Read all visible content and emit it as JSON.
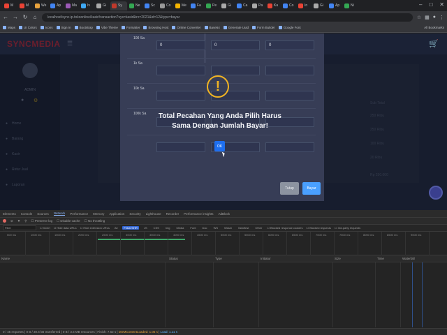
{
  "browser": {
    "tabs": [
      {
        "label": "M",
        "color": "#ea4335",
        "active": false
      },
      {
        "label": "M",
        "color": "#ea4335",
        "active": false
      },
      {
        "label": "We",
        "color": "#e8a33d",
        "active": false
      },
      {
        "label": "Ap",
        "color": "#4285f4",
        "active": false
      },
      {
        "label": "Ma",
        "color": "#9b59b6",
        "active": false
      },
      {
        "label": "Iv",
        "color": "#3fa9f5",
        "active": false
      },
      {
        "label": "Gi",
        "color": "#aaaaaa",
        "active": false
      },
      {
        "label": "Sy",
        "color": "#c0392b",
        "active": true
      },
      {
        "label": "Ne",
        "color": "#34a853",
        "active": false
      },
      {
        "label": "Sc",
        "color": "#4285f4",
        "active": false
      },
      {
        "label": "Co",
        "color": "#999999",
        "active": false
      },
      {
        "label": "Me",
        "color": "#f4b400",
        "active": false
      },
      {
        "label": "Fa",
        "color": "#4285f4",
        "active": false
      },
      {
        "label": "Pe",
        "color": "#34a853",
        "active": false
      },
      {
        "label": "Gi",
        "color": "#aaaaaa",
        "active": false
      },
      {
        "label": "Ca",
        "color": "#4285f4",
        "active": false
      },
      {
        "label": "Pa",
        "color": "#aaaaaa",
        "active": false
      },
      {
        "label": "Ku",
        "color": "#ea4335",
        "active": false
      },
      {
        "label": "Co",
        "color": "#4285f4",
        "active": false
      },
      {
        "label": "In",
        "color": "#ea4335",
        "active": false
      },
      {
        "label": "Gi",
        "color": "#aaaaaa",
        "active": false
      },
      {
        "label": "Ap",
        "color": "#4285f4",
        "active": false
      },
      {
        "label": "Ni",
        "color": "#34a853",
        "active": false
      }
    ],
    "url": "localhost/sync.ip.tokoonline/kasir/transaction?sys=kasir&trx=2021&id=12&type=bayar",
    "bookmarks": [
      "Maps",
      "UI Colors",
      "Icons",
      "Sign In",
      "Bootstrap",
      "Vibe Theme",
      "Formatter",
      "Browsing Host",
      "Online Converter",
      "Base64",
      "Generate Uuid",
      "Form Builder",
      "Google Font"
    ],
    "bookmarks_right": "All Bookmarks"
  },
  "app": {
    "logo": "SYNCMEDIA",
    "user": "ADMIN",
    "menu": [
      "Home",
      "Barang",
      "Kasir",
      "Retur Jual",
      "Laporan"
    ],
    "right_labels": [
      "Sub Total",
      "250 Ribu",
      "250 Ribu",
      "100 Ribu",
      "20 Ribu",
      "Rp 250.000"
    ]
  },
  "modal": {
    "rows": [
      {
        "label": "100 Sa",
        "v1": "0",
        "v2": "0",
        "v3": "0"
      },
      {
        "label": "1k Sa",
        "v1": "",
        "v2": "",
        "v3": ""
      },
      {
        "label": "10k Sa",
        "v1": "",
        "v2": "",
        "v3": ""
      },
      {
        "label": "100k Sa",
        "v1": "",
        "v2": "",
        "v3": ""
      },
      {
        "label": "",
        "v1": "",
        "v2": "",
        "v3": ""
      }
    ],
    "close_label": "Tutup",
    "pay_label": "Bayar"
  },
  "alert": {
    "icon": "!",
    "title": "Total Pecahan Yang Anda Pilih Harus Sama Dengan Jumlah Bayar!",
    "ok_label": "OK"
  },
  "devtools": {
    "tabs": [
      "Elements",
      "Console",
      "Sources",
      "Network",
      "Performance",
      "Memory",
      "Application",
      "Security",
      "Lighthouse",
      "Recorder",
      "Performance insights",
      "AdBlock"
    ],
    "active_tab": "Network",
    "toolbar": [
      "Preserve log",
      "Disable cache",
      "No throttling"
    ],
    "filter_placeholder": "Filter",
    "filter_options": [
      "Invert",
      "Hide data URLs",
      "Hide extension URLs"
    ],
    "type_chips": [
      "All",
      "Fetch/XHR",
      "JS",
      "CSS",
      "Img",
      "Media",
      "Font",
      "Doc",
      "WS",
      "Wasm",
      "Manifest",
      "Other"
    ],
    "type_active": "Fetch/XHR",
    "extra_filters": [
      "Blocked response cookies",
      "Blocked requests",
      "3rd-party requests"
    ],
    "ticks": [
      "500 ms",
      "1000 ms",
      "1500 ms",
      "2000 ms",
      "2500 ms",
      "3000 ms",
      "3500 ms",
      "4000 ms",
      "4500 ms",
      "5000 ms",
      "5500 ms",
      "6000 ms",
      "6500 ms",
      "7000 ms",
      "7500 ms",
      "8000 ms",
      "8500 ms",
      "9000 ms"
    ],
    "columns": [
      "Name",
      "Status",
      "Type",
      "Initiator",
      "Size",
      "Time",
      "Waterfall"
    ],
    "status": {
      "requests": "0 / 45 requests",
      "transferred": "0 B / 30.6 kB transferred",
      "resources": "0 B / 3.5 MB resources",
      "finish": "Finish: 7.62 s",
      "dom": "DOMContentLoaded: 1.05 s",
      "load": "Load: 1.11 s"
    }
  }
}
